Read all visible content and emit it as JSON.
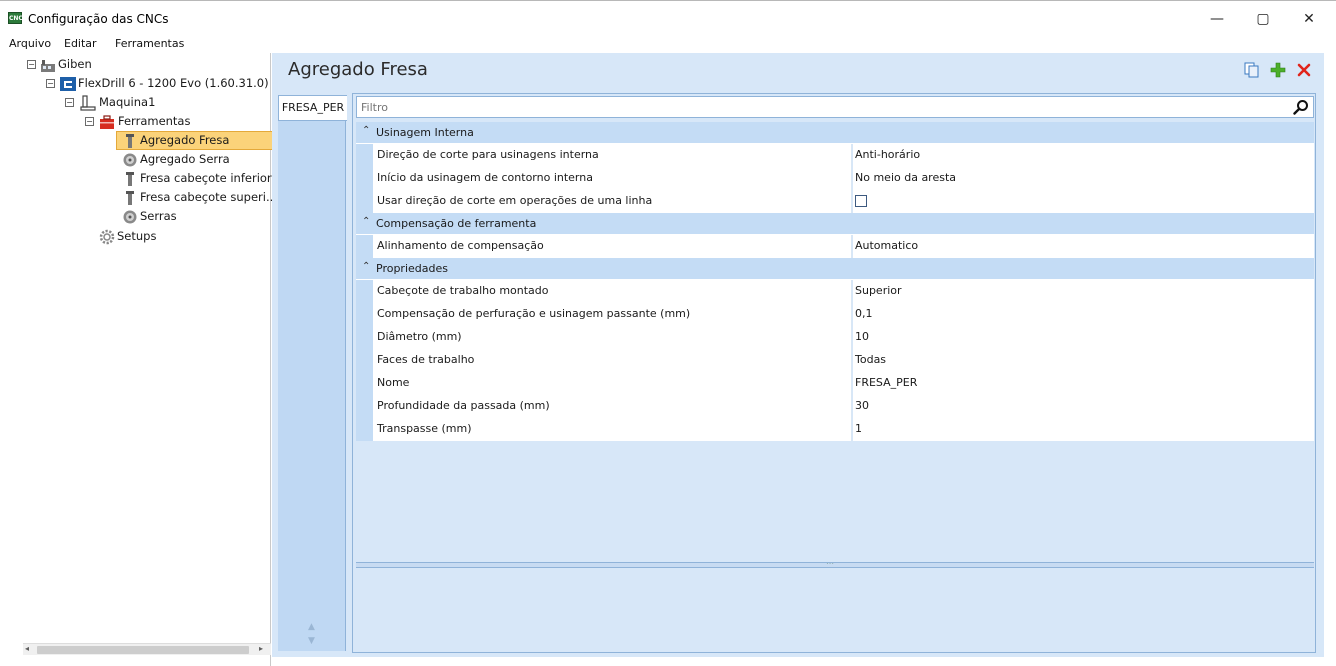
{
  "window": {
    "title": "Configuração das CNCs",
    "app_icon_text": "CNC",
    "buttons": {
      "minimize": "—",
      "maximize": "▢",
      "close": "✕"
    }
  },
  "menu": [
    "Arquivo",
    "Editar",
    "Ferramentas"
  ],
  "tree": {
    "root": "Giben",
    "machine": "FlexDrill 6 - 1200 Evo (1.60.31.0)",
    "maquina": "Maquina1",
    "ferramentas": "Ferramentas",
    "items": [
      "Agregado Fresa",
      "Agregado Serra",
      "Fresa cabeçote inferior",
      "Fresa cabeçote superi...",
      "Serras"
    ],
    "setups": "Setups",
    "selected": "Agregado Fresa"
  },
  "panel": {
    "title": "Agregado Fresa",
    "tab": "FRESA_PER",
    "filter_placeholder": "Filtro"
  },
  "categories": [
    {
      "label": "Usinagem Interna",
      "rows": [
        {
          "name": "Direção de corte para usinagens interna",
          "value": "Anti-horário"
        },
        {
          "name": "Início da usinagem de contorno interna",
          "value": "No meio da aresta"
        },
        {
          "name": "Usar direção de corte em operações de uma linha",
          "value": "",
          "checkbox": true,
          "checked": false
        }
      ]
    },
    {
      "label": "Compensação de ferramenta",
      "rows": [
        {
          "name": "Alinhamento de compensação",
          "value": "Automatico"
        }
      ]
    },
    {
      "label": "Propriedades",
      "rows": [
        {
          "name": "Cabeçote de trabalho montado",
          "value": "Superior"
        },
        {
          "name": "Compensação de perfuração e usinagem passante (mm)",
          "value": "0,1"
        },
        {
          "name": "Diâmetro (mm)",
          "value": "10"
        },
        {
          "name": "Faces de trabalho",
          "value": "Todas"
        },
        {
          "name": "Nome",
          "value": "FRESA_PER"
        },
        {
          "name": "Profundidade da passada (mm)",
          "value": "30"
        },
        {
          "name": "Transpasse (mm)",
          "value": "1"
        }
      ]
    }
  ],
  "colors": {
    "selection": "#fbd37a",
    "panel_bg": "#d7e7f8",
    "category_bg": "#c4dcf5",
    "add_icon": "#4caf2a",
    "delete_icon": "#e0241b"
  }
}
